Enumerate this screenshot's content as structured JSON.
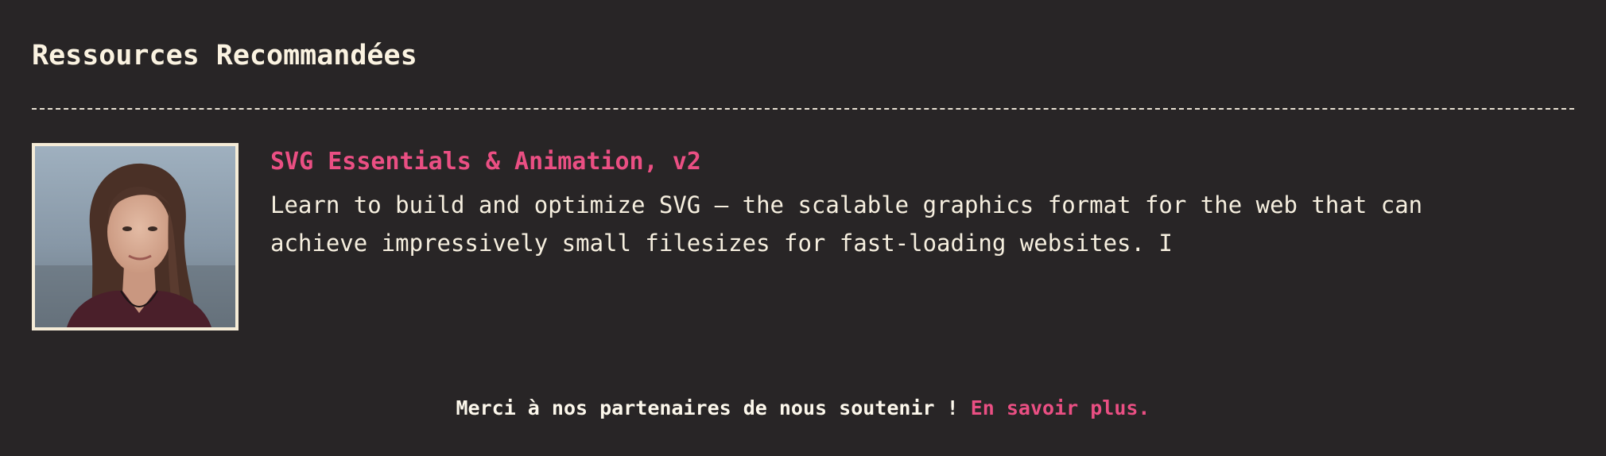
{
  "section": {
    "title": "Ressources Recommandées"
  },
  "resource": {
    "title": "SVG Essentials & Animation, v2",
    "description": "Learn to build and optimize SVG – the scalable graphics format for the web that can achieve impressively small filesizes for fast-loading websites. I",
    "thumbnail_alt": "Instructor portrait"
  },
  "footer": {
    "text": "Merci à nos partenaires de nous soutenir ! ",
    "link_label": "En savoir plus."
  },
  "colors": {
    "background": "#282526",
    "accent": "#ea4f83",
    "text": "#fdf6e3"
  }
}
